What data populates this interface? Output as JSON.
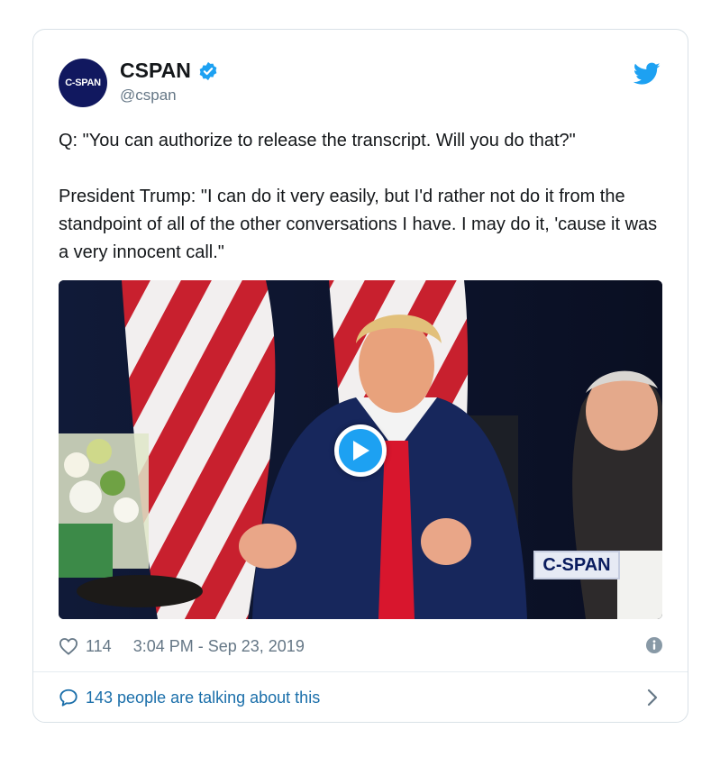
{
  "account": {
    "avatar_text": "C-SPAN",
    "display_name": "CSPAN",
    "handle": "@cspan",
    "verified": true
  },
  "tweet": {
    "text": "Q: \"You can authorize to release the transcript. Will you do that?\"\n\nPresident Trump: \"I can do it very easily, but I'd rather not do it from the standpoint of all of the other conversations I have. I may do it, 'cause it was a very innocent call.\""
  },
  "media": {
    "type": "video",
    "watermark": "C-SPAN"
  },
  "meta": {
    "likes": "114",
    "timestamp": "3:04 PM - Sep 23, 2019"
  },
  "footer": {
    "conversation": "143 people are talking about this"
  },
  "icons": {
    "verified": "verified-badge-icon",
    "brand": "twitter-bird-icon",
    "like": "heart-icon",
    "info": "info-icon",
    "play": "play-icon",
    "reply": "speech-bubble-icon",
    "more": "chevron-right-icon"
  },
  "colors": {
    "accent": "#1da1f2",
    "link": "#1b6faa",
    "muted": "#657786",
    "avatar_bg": "#11185f"
  }
}
